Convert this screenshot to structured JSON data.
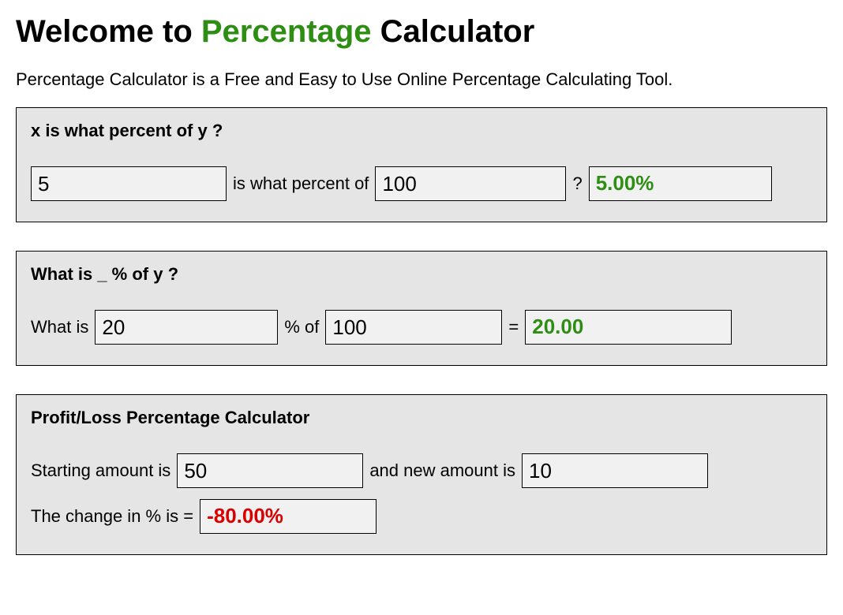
{
  "header": {
    "prefix": "Welcome to ",
    "highlight": "Percentage",
    "suffix": " Calculator"
  },
  "intro": "Percentage Calculator is a Free and Easy to Use Online Percentage Calculating Tool.",
  "panel1": {
    "title": "x is what percent of y ?",
    "x": "5",
    "mid_text": "is what percent of",
    "y": "100",
    "q": "?",
    "result": "5.00%"
  },
  "panel2": {
    "title": "What is _ % of y ?",
    "lead": "What is",
    "p": "20",
    "mid_text": "% of",
    "y": "100",
    "eq": "=",
    "result": "20.00"
  },
  "panel3": {
    "title": "Profit/Loss Percentage Calculator",
    "lead": "Starting amount is",
    "start": "50",
    "mid_text": "and new amount is",
    "end": "10",
    "result_label": "The change in % is =",
    "result": "-80.00%"
  }
}
